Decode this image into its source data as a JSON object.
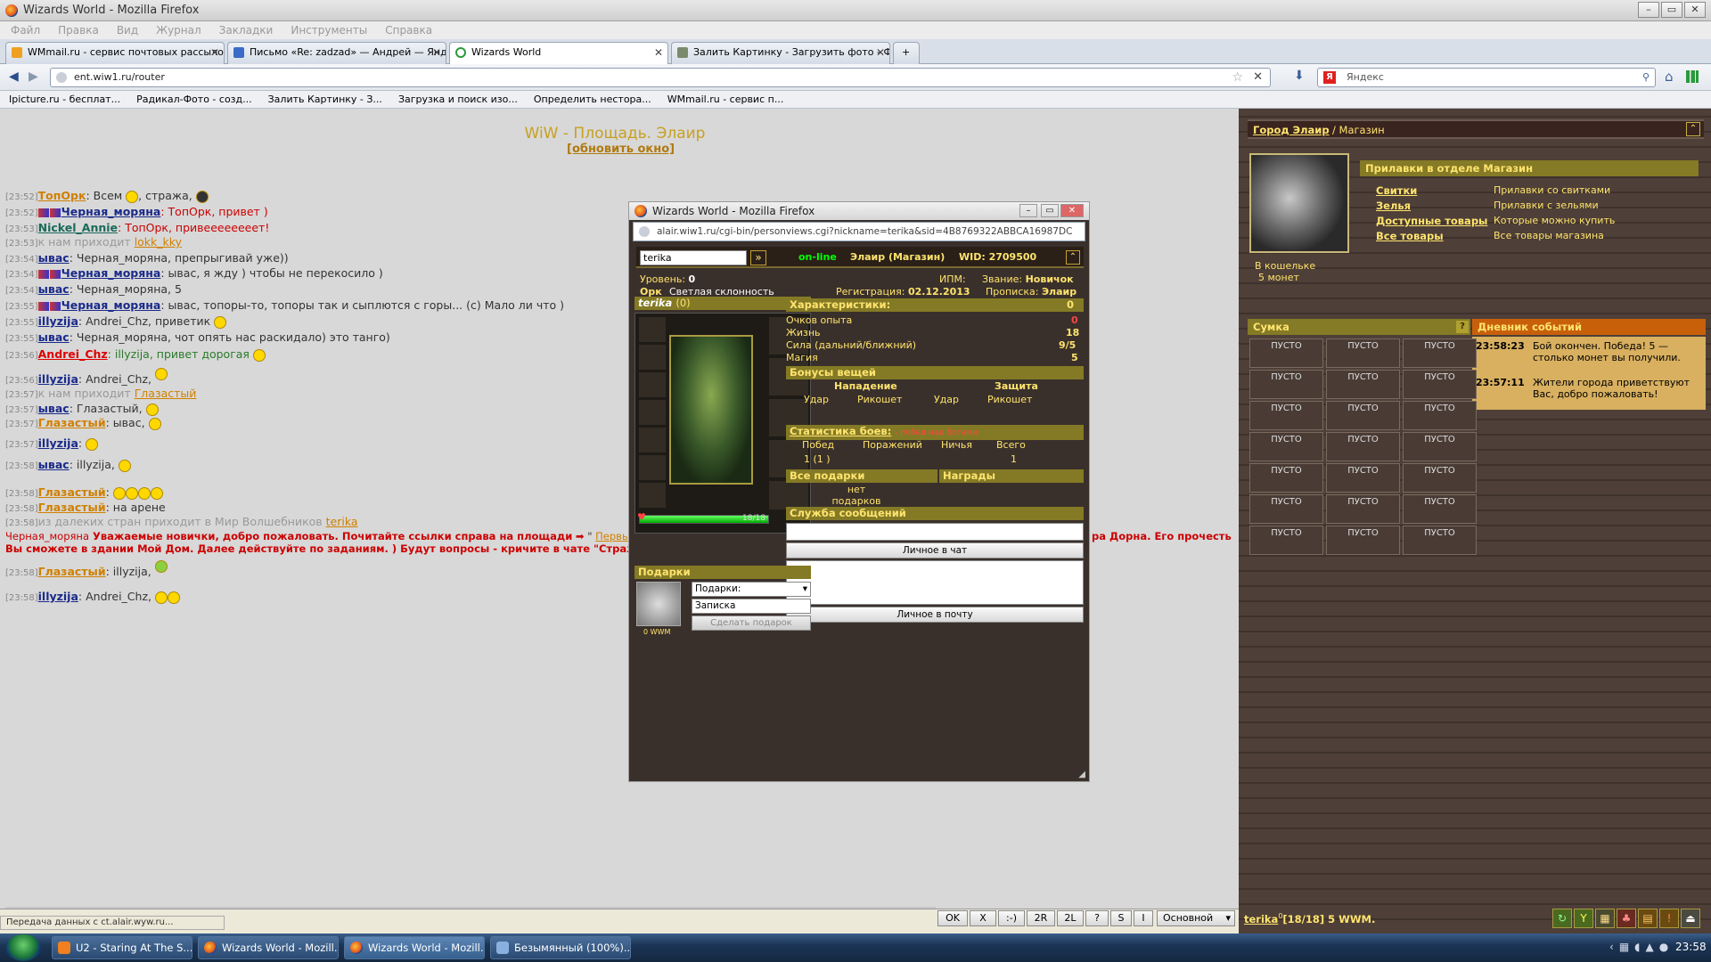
{
  "window": {
    "title": "Wizards World - Mozilla Firefox"
  },
  "menu": [
    "Файл",
    "Правка",
    "Вид",
    "Журнал",
    "Закладки",
    "Инструменты",
    "Справка"
  ],
  "tabs": [
    {
      "label": "WMmail.ru - сервис почтовых рассылок..."
    },
    {
      "label": "Письмо «Re: zadzad» — Андрей — Янд..."
    },
    {
      "label": "Wizards World"
    },
    {
      "label": "Залить Картинку - Загрузить фото - Ф..."
    }
  ],
  "nav": {
    "url": "ent.wiw1.ru/router",
    "search_placeholder": "Яндекс"
  },
  "bookmarks": [
    "Ipicture.ru - бесплат...",
    "Радикал-Фото - созд...",
    "Залить Картинку - З...",
    "Загрузка и поиск изо...",
    "Определить нестора...",
    "WMmail.ru - сервис п..."
  ],
  "chat": {
    "title": "WiW - Площадь. Элаир",
    "refresh": "[обновить окно]",
    "lines": [
      {
        "t": "[23:52]",
        "n": "ТопОрк",
        "msg": ": Всем ",
        "msg2": ", стража,"
      },
      {
        "t": "[23:52]",
        "n": "Черная_моряна",
        "msg": ": ТопОрк, привет )"
      },
      {
        "t": "[23:53]",
        "n": "Nickel_Annie",
        "msg": ": ТопОрк, привеееееееет!"
      },
      {
        "t": "[23:53]",
        "sys": "к нам приходит ",
        "n": "lokk_kky"
      },
      {
        "t": "[23:54]",
        "n": "ывас",
        "msg": ": Черная_моряна, препрыгивай уже))"
      },
      {
        "t": "[23:54]",
        "n": "Черная_моряна",
        "msg": ": ывас, я жду ) чтобы не перекосило )"
      },
      {
        "t": "[23:54]",
        "n": "ывас",
        "msg": ": Черная_моряна, 5"
      },
      {
        "t": "[23:55]",
        "n": "Черная_моряна",
        "msg": ": ывас, топоры-то, топоры так и сыплются с горы... (с) Мало ли что )"
      },
      {
        "t": "[23:55]",
        "n": "illyzija",
        "msg": ": Andrei_Chz, приветик"
      },
      {
        "t": "[23:55]",
        "n": "ывас",
        "msg": ": Черная_моряна, чот опять нас раскидало) это танго)"
      },
      {
        "t": "[23:56]",
        "n": "Andrei_Chz",
        "msg": ": illyzija, привет дорогая"
      },
      {
        "t": "[23:56]",
        "n": "illyzija",
        "msg": ": Andrei_Chz,"
      },
      {
        "t": "[23:57]",
        "sys": "к нам приходит ",
        "n": "Глазастый"
      },
      {
        "t": "[23:57]",
        "n": "ывас",
        "msg": ": Глазастый,"
      },
      {
        "t": "[23:57]",
        "n": "Глазастый",
        "msg": ": ывас,"
      },
      {
        "t": "[23:57]",
        "n": "illyzija",
        "msg": ":"
      },
      {
        "t": "[23:58]",
        "n": "ывас",
        "msg": ": illyzija,"
      },
      {
        "t": "[23:58]",
        "n": "Глазастый",
        "msg": ":"
      },
      {
        "t": "[23:58]",
        "n": "Глазастый",
        "msg": ": на арене"
      },
      {
        "t": "[23:58]",
        "sys": "из далеких стран приходит в Мир Волшебников ",
        "n": "terika"
      },
      {
        "t": "",
        "n": "Черная_моряна",
        "msg": " Уважаемые новички, добро пожаловать. Почитайте ссылки справа на площади",
        "link": "Первый шаг"
      },
      {
        "t": "",
        "msg": "Вы сможете в здании Мой Дом. Далее действуйте по заданиям. ) Будут вопросы - кричите в чате \"Стража\". Вам с"
      },
      {
        "t": "[23:58]",
        "n": "Глазастый",
        "msg": ": illyzija,"
      },
      {
        "t": "[23:58]",
        "n": "illyzija",
        "msg": ": Andrei_Chz,"
      }
    ],
    "overflow_text": "ра Дорна. Его прочесть",
    "buttons": [
      "OK",
      "X",
      ":-)",
      "2R",
      "2L",
      "?",
      "S",
      "I"
    ],
    "channel": "Основной",
    "status": "Передача данных с ct.alair.wyw.ru..."
  },
  "popup": {
    "title": "Wizards World - Mozilla Firefox",
    "url": "alair.wiw1.ru/cgi-bin/personviews.cgi?nickname=terika&sid=4B8769322ABBCA16987DC",
    "nick": "terika",
    "online": "on-line",
    "location": "Элаир (Магазин)",
    "wid": "WID: 2709500",
    "level_label": "Уровень:",
    "level": "0",
    "ipm_label": "ИПМ:",
    "rank_label": "Звание:",
    "rank": "Новичок",
    "race": "Орк",
    "alignment": "Светлая склонность",
    "reg_label": "Регистрация:",
    "reg": "02.12.2013",
    "home_label": "Прописка:",
    "home": "Элаир",
    "char_name": "terika",
    "char_count": "(0)",
    "hp": "18/18",
    "hp_fraction": 1,
    "stats_title": "Характеристики:",
    "stats_count": "0",
    "stats": [
      {
        "label": "Очков опыта",
        "value": "0"
      },
      {
        "label": "Жизнь",
        "value": "18"
      },
      {
        "label": "Сила (дальний/ближний)",
        "value": "9/5"
      },
      {
        "label": "Магия",
        "value": "5"
      }
    ],
    "bonus_title": "Бонусы вещей",
    "attack": "Нападение",
    "defense": "Защита",
    "hit": "Удар",
    "ricochet": "Рикошет",
    "battles_title": "Статистика боев:",
    "battles_note": "- побед над ботами",
    "wins": "Побед",
    "losses": "Поражений",
    "draws": "Ничья",
    "total": "Всего",
    "wins_val": "1 (1 )",
    "total_val": "1",
    "gifts_all": "Все подарки",
    "awards": "Награды",
    "no_gifts": "нет подарков",
    "msg_title": "Служба сообщений",
    "to_chat": "Личное в чат",
    "to_mail": "Личное в почту",
    "gifts_title": "Подарки",
    "gift_select": "Подарки:",
    "note_placeholder": "Записка",
    "make_gift": "Сделать подарок",
    "wwm": "0 WWM"
  },
  "right": {
    "breadcrumb_city": "Город Элаир",
    "breadcrumb_sep": " / ",
    "breadcrumb_place": "Магазин",
    "shop_header": "Прилавки в отделе ",
    "shop_header_place": "Магазин",
    "wallet_label": "В кошельке",
    "wallet_value": "5 монет",
    "shop_items": [
      {
        "link": "Свитки",
        "desc": "Прилавки со свитками"
      },
      {
        "link": "Зелья",
        "desc": "Прилавки с зельями"
      },
      {
        "link": "Доступные товары",
        "desc": "Которые можно купить"
      },
      {
        "link": "Все товары",
        "desc": "Все товары магазина"
      }
    ],
    "bag_title": "Сумка",
    "bag_help": "?",
    "empty": "ПУСТО",
    "diary_title": "Дневник событий",
    "diary": [
      {
        "time": "23:58:23",
        "text": "Бой окончен. Победа! 5 — столько монет вы получили."
      },
      {
        "time": "23:57:11",
        "text": "Жители города приветствуют Вас, добро пожаловать!"
      }
    ],
    "footer_nick": "terika",
    "footer_sup": "0",
    "footer_info": "[18/18] 5 WWM."
  },
  "taskbar": {
    "items": [
      "U2 - Staring At The S...",
      "Wizards World - Mozill...",
      "Wizards World - Mozill...",
      "Безымянный (100%)..."
    ],
    "clock": "23:58"
  }
}
